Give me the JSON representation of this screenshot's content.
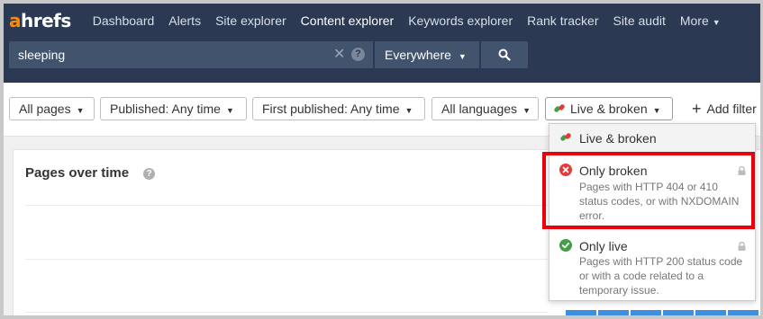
{
  "brand": {
    "logo_a": "a",
    "logo_rest": "hrefs"
  },
  "nav": {
    "items": [
      "Dashboard",
      "Alerts",
      "Site explorer",
      "Content explorer",
      "Keywords explorer",
      "Rank tracker",
      "Site audit",
      "More"
    ],
    "active": "Content explorer"
  },
  "search": {
    "value": "sleeping",
    "scope": "Everywhere",
    "clear_icon": "close-icon",
    "help_icon": "question-icon",
    "button_icon": "search-icon"
  },
  "filters": {
    "all_pages": "All pages",
    "published": "Published: Any time",
    "first_published": "First published: Any time",
    "languages": "All languages",
    "live_broken": "Live & broken",
    "add_filter": "Add filter"
  },
  "chart_card": {
    "title": "Pages over time"
  },
  "dropdown": {
    "options": [
      {
        "label": "Live & broken",
        "icon": "link-icon",
        "description": ""
      },
      {
        "label": "Only broken",
        "icon": "error-icon",
        "description": "Pages with HTTP 404 or 410 status codes, or with NXDOMAIN error.",
        "locked": true
      },
      {
        "label": "Only live",
        "icon": "check-icon",
        "description": "Pages with HTTP 200 status code or with a code related to a temporary issue.",
        "locked": true
      }
    ],
    "highlighted": "Only broken"
  },
  "colors": {
    "nav_bg": "#2b3a52",
    "accent_orange": "#ff8800",
    "error_red": "#e53935",
    "success_green": "#43a047",
    "highlight_red": "#e8000b",
    "bar_blue": "#3f8fe0"
  }
}
